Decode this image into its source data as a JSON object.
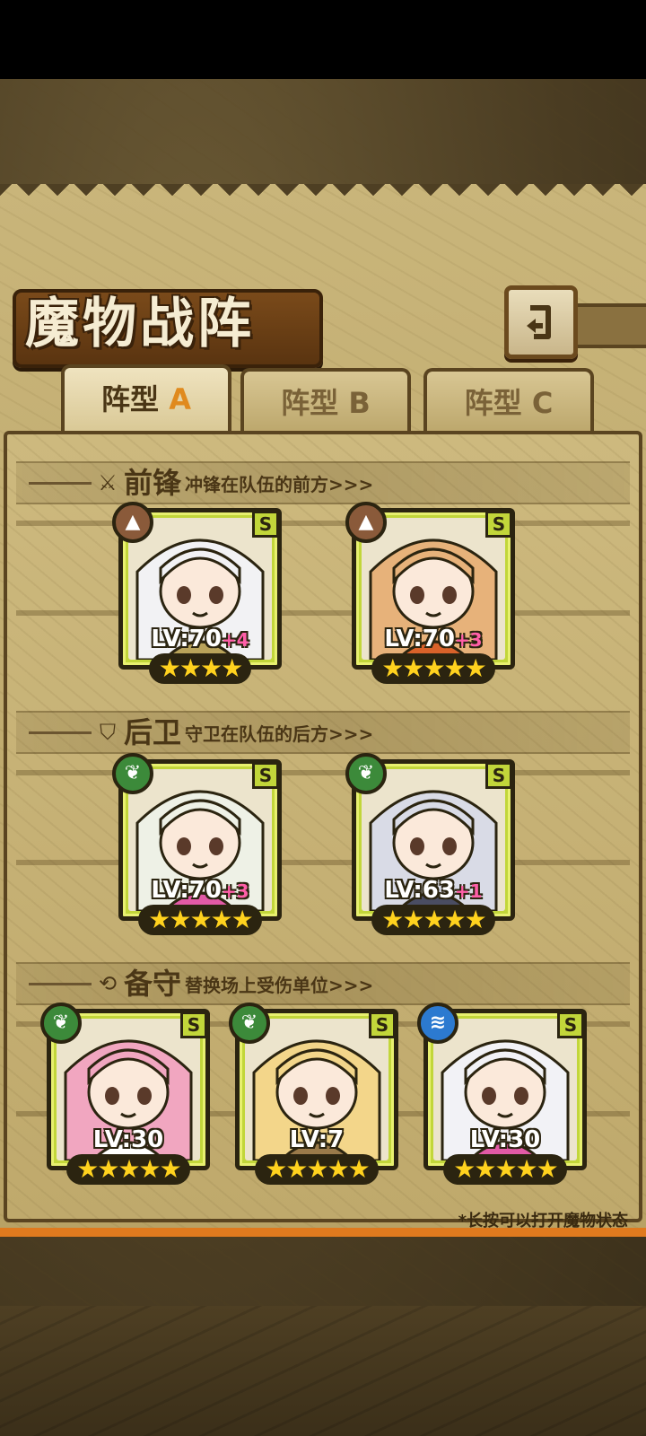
{
  "title": "魔物战阵",
  "back_button": {
    "icon": "back-arrow-icon"
  },
  "tabs": [
    {
      "label": "阵型",
      "letter": "A",
      "active": true
    },
    {
      "label": "阵型",
      "letter": "B",
      "active": false
    },
    {
      "label": "阵型",
      "letter": "C",
      "active": false
    }
  ],
  "sections": [
    {
      "name": "前锋",
      "desc": "冲锋在队伍的前方>>>",
      "icon": "sword-icon",
      "units": [
        {
          "element": "earth",
          "rank": "S",
          "level": "LV:70",
          "bonus": "+4",
          "stars": 4,
          "hair": "#f2f2f4",
          "accent": "#b9a35a"
        },
        {
          "element": "earth",
          "rank": "S",
          "level": "LV:70",
          "bonus": "+3",
          "stars": 5,
          "hair": "#e7b27a",
          "accent": "#d9622a"
        }
      ]
    },
    {
      "name": "后卫",
      "desc": "守卫在队伍的后方>>>",
      "icon": "shield-icon",
      "units": [
        {
          "element": "nature",
          "rank": "S",
          "level": "LV:70",
          "bonus": "+3",
          "stars": 5,
          "hair": "#eef1e6",
          "accent": "#e25aa6"
        },
        {
          "element": "nature",
          "rank": "S",
          "level": "LV:63",
          "bonus": "+1",
          "stars": 5,
          "hair": "#d9dbe6",
          "accent": "#4a4d62"
        }
      ]
    },
    {
      "name": "备守",
      "desc": "替换场上受伤单位>>>",
      "icon": "swap-icon",
      "units": [
        {
          "element": "nature",
          "rank": "S",
          "level": "LV:30",
          "bonus": "",
          "stars": 5,
          "hair": "#f1a6c0",
          "accent": "#ffffff"
        },
        {
          "element": "nature",
          "rank": "S",
          "level": "LV:7",
          "bonus": "",
          "stars": 5,
          "hair": "#f3d68a",
          "accent": "#9a7a4a"
        },
        {
          "element": "water",
          "rank": "S",
          "level": "LV:30",
          "bonus": "",
          "stars": 5,
          "hair": "#f2f2f6",
          "accent": "#e25aa6"
        }
      ]
    }
  ],
  "hint": "*长按可以打开魔物状态",
  "colors": {
    "accent_orange": "#e08a1e",
    "card_green": "#c2d63a",
    "frame_brown": "#5a4420",
    "bonus_pink": "#ff5fa8",
    "star_gold": "#ffd21e"
  }
}
